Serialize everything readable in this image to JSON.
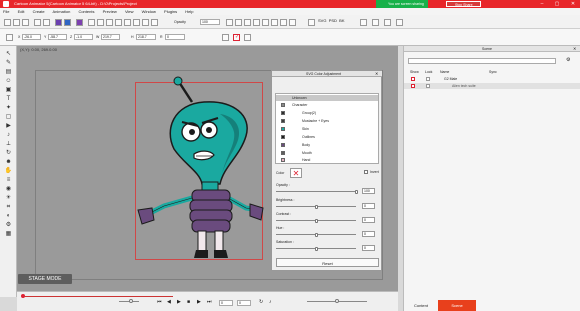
{
  "titlebar": {
    "title": "Cartoon Animator 5(Cartoon Animator 5 64-bit) - D:\\0\\Projects\\Project",
    "sharing_notice": "You are screen sharing",
    "stop_share_label": "Stop Share",
    "colors": {
      "bar": "#e8262a",
      "share": "#18b14a"
    }
  },
  "menubar": {
    "items": [
      "File",
      "Edit",
      "Create",
      "Animation",
      "Contents",
      "Preview",
      "View",
      "Window",
      "Plugins",
      "Help"
    ]
  },
  "toolbar": {
    "opacity_label": "Opacity",
    "opacity_value": "100",
    "x_label": "X",
    "x_value": "-26.0",
    "y_label": "Y",
    "y_value": "-58.7",
    "z_label": "Z",
    "z_value": "-1.0",
    "w_label": "W",
    "w_value": "219.7",
    "h_label": "H",
    "h_value": "218.7",
    "r_label": "R",
    "r_value": "0",
    "project_buttons": [
      "SVG",
      "PSD",
      "BK"
    ]
  },
  "stage": {
    "coordinates": "(X,Y): 0.00, 269.0.00",
    "mode_badge": "STAGE MODE"
  },
  "svg_dialog": {
    "title": "SVG Color Adjustment",
    "tree": [
      {
        "label": "Unknown",
        "selected": true,
        "swatch": ""
      },
      {
        "label": "Character",
        "swatch": "#8a8a8a"
      },
      {
        "label": "Group(2)",
        "swatch": "#2e2e2e"
      },
      {
        "label": "Mustache + Eyes",
        "swatch": "#3d3d3d"
      },
      {
        "label": "Skin",
        "swatch": "#1aa9a0"
      },
      {
        "label": "Outlines",
        "swatch": "#1b1b1b"
      },
      {
        "label": "Body",
        "swatch": "#6a4b7e"
      },
      {
        "label": "Mouth",
        "swatch": "#5e5e5e"
      },
      {
        "label": "Hand",
        "swatch": "#e6b3c4"
      }
    ],
    "color_label": "Color",
    "invert_label": "Invert",
    "opacity_label": "Opacity :",
    "opacity_value": "100",
    "opacity_level": 1.0,
    "brightness_label": "Brightness :",
    "brightness_value": "0",
    "brightness_level": 0.5,
    "contrast_label": "Contrast :",
    "contrast_value": "0",
    "contrast_level": 0.5,
    "hue_label": "Hue :",
    "hue_value": "0",
    "hue_level": 0.5,
    "saturation_label": "Saturation :",
    "saturation_value": "0",
    "saturation_level": 0.5,
    "reset_label": "Reset"
  },
  "scene_panel": {
    "title": "Scene",
    "columns": {
      "show": "Show",
      "lock": "Lock",
      "name": "Name",
      "sync": "Sync"
    },
    "rows": [
      {
        "name": "G2 Male"
      },
      {
        "name": "Alien tech suite"
      }
    ],
    "tabs": [
      "Content",
      "Scene"
    ],
    "active_tab": "Scene",
    "accent": "#e8401c"
  },
  "timeline": {
    "frame_value": "0",
    "total_value": "0"
  }
}
